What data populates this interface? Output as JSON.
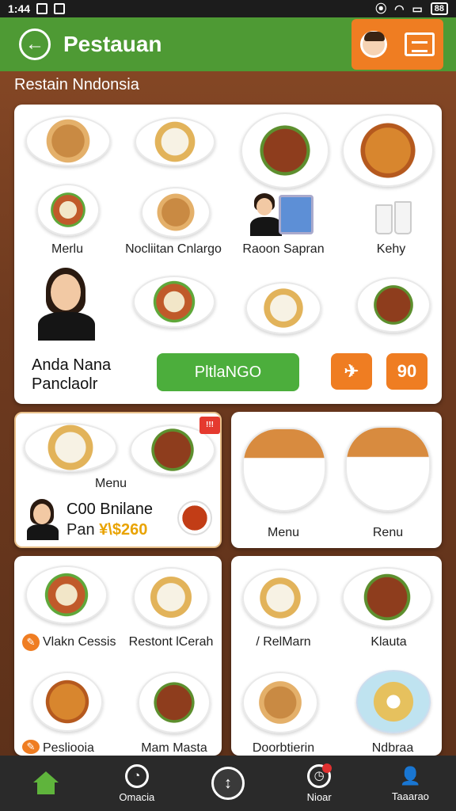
{
  "status_bar": {
    "time": "1:44",
    "battery": "88"
  },
  "app_bar": {
    "title": "Pestauan",
    "back_glyph": "←"
  },
  "subtitle": "Restain Nndonsia",
  "featured": {
    "labels": [
      "Merlu",
      "Nocliitan Cnlargo",
      "Raoon Sapran",
      "Kehy"
    ],
    "person_name": "Anda Nana",
    "person_role": "Panclaolr",
    "primary_button": "PltlaNGO",
    "icon_button_1": "✈",
    "icon_button_2": "90"
  },
  "card_a": {
    "label": "Menu",
    "badge": "!!!",
    "title": "C00 Bnilane",
    "price_prefix": "Pan",
    "price_value": "¥\\$260"
  },
  "card_b": {
    "label_left": "Menu",
    "label_right": "Renu"
  },
  "card_c": {
    "label_1": "Vlakn Cessis",
    "label_2": "Restont lCerah",
    "label_3": "Pesliooia",
    "label_4": "Mam Masta"
  },
  "card_d": {
    "label_1": "/ RelMarn",
    "label_2": "Klauta",
    "label_3": "Doorbtierin",
    "label_4": "Ndbraa"
  },
  "nav": {
    "item_2": "Omacia",
    "item_3_glyph": "↕",
    "item_4": "Nioar",
    "item_5": "Taaarao"
  },
  "colors": {
    "green": "#4e9a34",
    "orange": "#ef7d22",
    "nav_bg": "#2a2a2a"
  }
}
